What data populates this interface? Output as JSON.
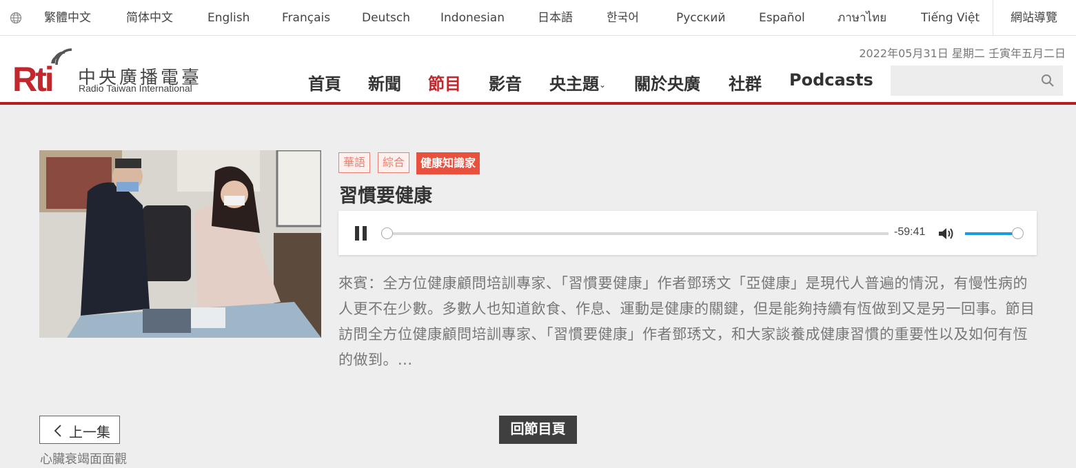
{
  "languages": [
    "繁體中文",
    "简体中文",
    "English",
    "Français",
    "Deutsch",
    "Indonesian",
    "日本語",
    "한국어",
    "Русский",
    "Español",
    "ภาษาไทย",
    "Tiếng Việt",
    "網站導覽"
  ],
  "logo": {
    "mark": "Rti",
    "name_cn": "中央廣播電臺",
    "name_en": "Radio Taiwan International"
  },
  "date": "2022年05月31日  星期二  壬寅年五月二日",
  "nav": [
    "首頁",
    "新聞",
    "節目",
    "影音",
    "央主題",
    "關於央廣",
    "社群",
    "Podcasts"
  ],
  "nav_active": "節目",
  "search": {
    "placeholder": ""
  },
  "episode": {
    "tags": [
      "華語",
      "綜合",
      "健康知識家"
    ],
    "title": "習慣要健康",
    "description": "來賓：全方位健康顧問培訓專家、「習慣要健康」作者鄧琇文「亞健康」是現代人普遍的情況，有慢性病的人更不在少數。多數人也知道飲食、作息、運動是健康的關鍵，但是能夠持續有恆做到又是另一回事。節目訪問全方位健康顧問培訓專家、「習慣要健康」作者鄧琇文，和大家談養成健康習慣的重要性以及如何有恆的做到。..."
  },
  "player": {
    "remaining": "-59:41",
    "progress": 0.0,
    "volume": 1.0,
    "state": "playing"
  },
  "pager": {
    "prev_label": "上一集",
    "prev_title": "心臟衰竭面面觀",
    "back_label": "回節目頁"
  },
  "colors": {
    "brand_red": "#b81c22",
    "tag_red": "#e8513d",
    "volume_blue": "#1a9be0"
  }
}
